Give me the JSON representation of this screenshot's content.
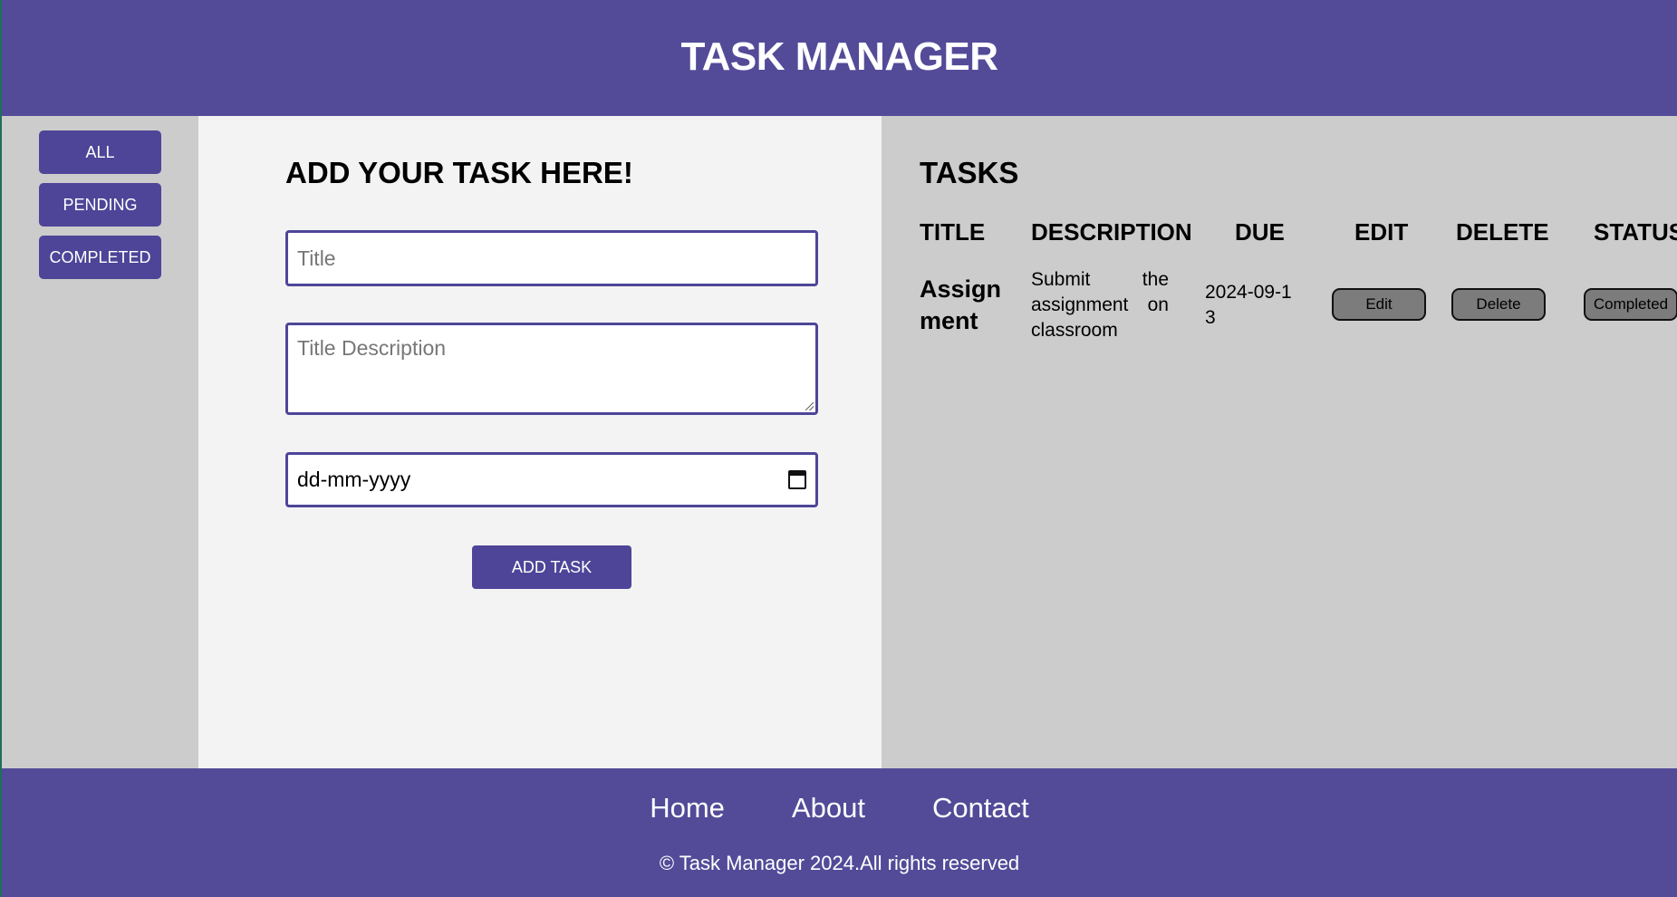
{
  "header": {
    "title": "TASK MANAGER"
  },
  "filters": [
    "ALL",
    "PENDING",
    "COMPLETED"
  ],
  "form": {
    "heading": "ADD YOUR TASK HERE!",
    "title_placeholder": "Title",
    "description_placeholder": "Title Description",
    "date_placeholder": "dd-mm-yyyy",
    "submit_label": "ADD TASK"
  },
  "tasks": {
    "heading": "TASKS",
    "columns": [
      "TITLE",
      "DESCRIPTION",
      "DUE",
      "EDIT",
      "DELETE",
      "STATUS"
    ],
    "rows": [
      {
        "title": "Assignment",
        "description": "Submit the assignment on classroom",
        "due": "2024-09-13",
        "edit_label": "Edit",
        "delete_label": "Delete",
        "status_label": "Completed"
      }
    ]
  },
  "footer": {
    "links": [
      "Home",
      "About",
      "Contact"
    ],
    "copyright": "© Task Manager 2024.All rights reserved"
  },
  "colors": {
    "brand": "#534b98",
    "button": "#4e4598",
    "sidebar_bg": "#cccccc",
    "form_bg": "#f3f3f3",
    "row_button": "#7c7c7c"
  }
}
